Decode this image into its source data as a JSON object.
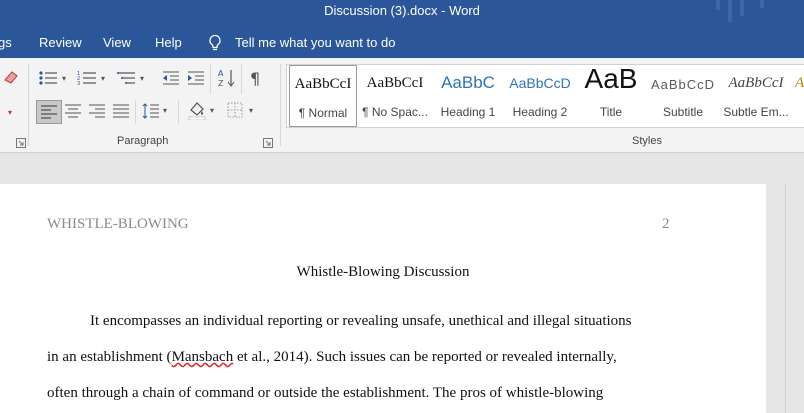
{
  "window": {
    "title": "Discussion (3).docx  -  Word"
  },
  "menu": {
    "items": [
      "gs",
      "Review",
      "View",
      "Help"
    ],
    "tell_me": "Tell me what you want to do"
  },
  "ribbon": {
    "paragraph_label": "Paragraph",
    "styles_label": "Styles",
    "styles": [
      {
        "preview": "AaBbCcI",
        "name": "¶ Normal"
      },
      {
        "preview": "AaBbCcI",
        "name": "¶ No Spac..."
      },
      {
        "preview": "AaBbC",
        "name": "Heading 1"
      },
      {
        "preview": "AaBbCcD",
        "name": "Heading 2"
      },
      {
        "preview": "AaB",
        "name": "Title"
      },
      {
        "preview": "AaBbCcD",
        "name": "Subtitle"
      },
      {
        "preview": "AaBbCcI",
        "name": "Subtle Em..."
      }
    ],
    "accent_color": "#2b579a"
  },
  "document": {
    "header_left": "WHISTLE-BLOWING",
    "page_number": "2",
    "title": "Whistle-Blowing Discussion",
    "line1": "It encompasses an individual reporting or revealing unsafe, unethical and illegal situations",
    "line2_pre": "in an establishment (",
    "line2_err": "Mansbach",
    "line2_post": " et al., 2014). Such issues can be reported or revealed internally,",
    "line3": "often through a chain of command or outside the establishment. The pros of whistle-blowing"
  }
}
